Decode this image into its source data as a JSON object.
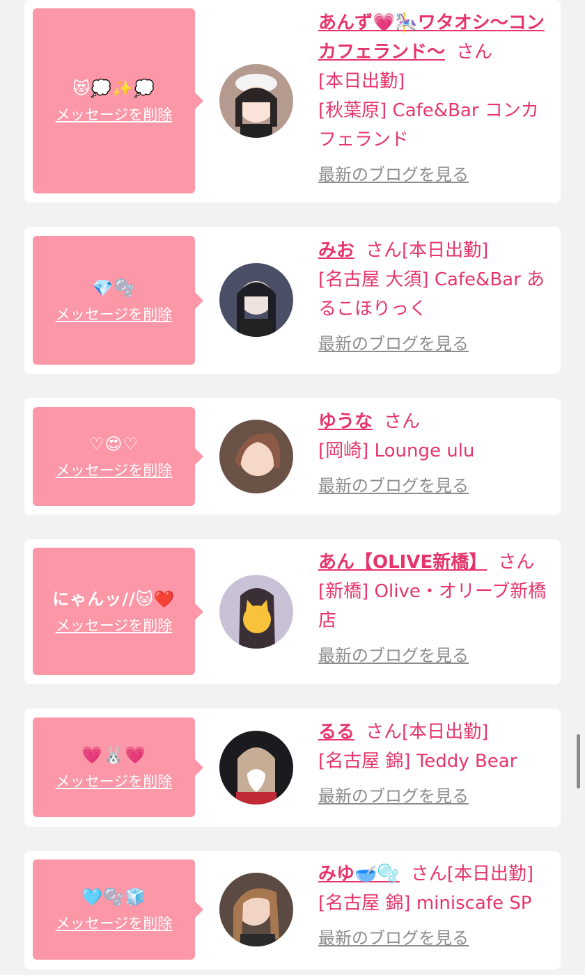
{
  "delete_label": "メッセージを削除",
  "san_label": "さん",
  "blog_label": "最新のブログを見る",
  "colors": {
    "accent": "#e6356c",
    "bubble": "#fc97a7",
    "link_gray": "#8c8c8c"
  },
  "cards": [
    {
      "message": "😻💭✨💭",
      "name": "あんず💗🎠ワタオシ〜コンカフェランド〜",
      "today": "[本日出勤]",
      "shop": "[秋葉原] Cafe&Bar コンカフェランド"
    },
    {
      "message": "💎🫧",
      "name": "みお",
      "today": "[本日出勤]",
      "shop": "[名古屋 大須] Cafe&Bar あるこほりっく"
    },
    {
      "message": "♡😍♡",
      "name": "ゆうな",
      "today": "",
      "shop": "[岡崎] Lounge ulu"
    },
    {
      "message": "にゃんッ//🐱❤️",
      "name": "あん【OLIVE新橋】",
      "today": "",
      "shop": "[新橋] Olive・オリーブ新橋店"
    },
    {
      "message": "💗🐰💗",
      "name": "るる",
      "today": "[本日出勤]",
      "shop": "[名古屋 錦] Teddy Bear"
    },
    {
      "message": "🩵🫧🧊",
      "name": "みゆ🥣🫧",
      "today": "[本日出勤]",
      "shop": "[名古屋 錦] miniscafe SP"
    }
  ]
}
